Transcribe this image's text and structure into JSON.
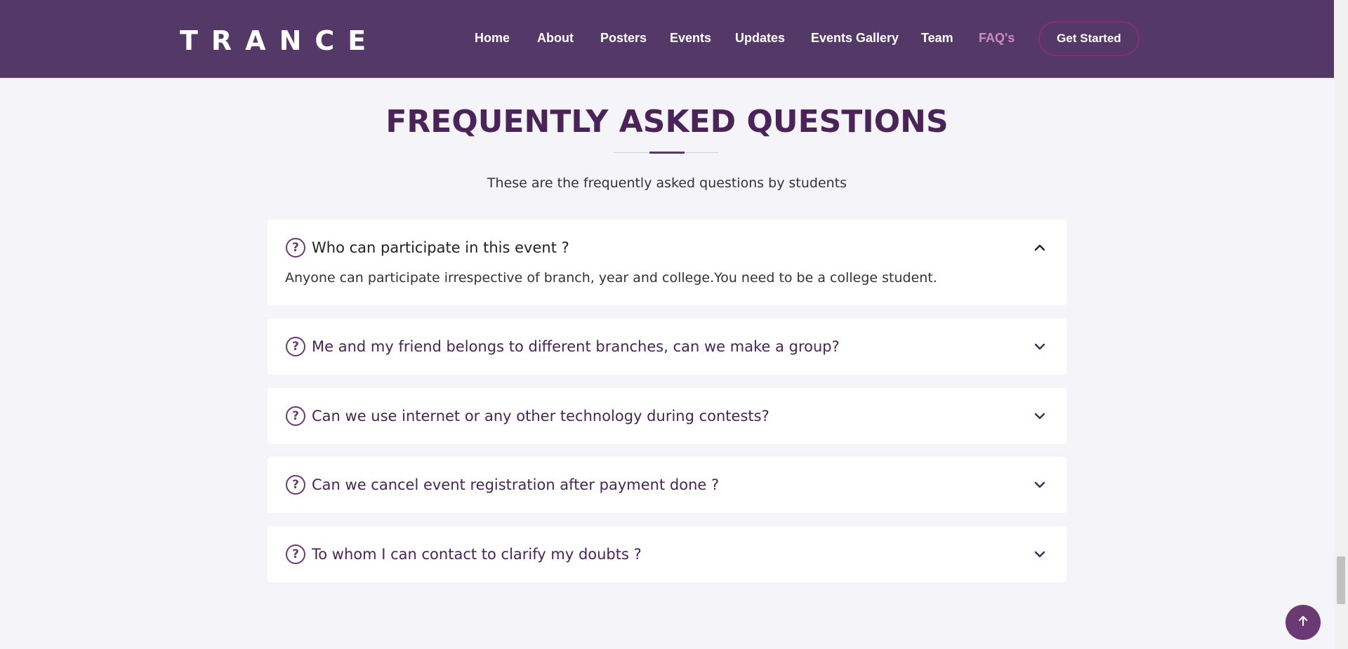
{
  "header": {
    "logo": "TRANCE",
    "nav": [
      {
        "label": "Home",
        "active": false
      },
      {
        "label": "About",
        "active": false
      },
      {
        "label": "Posters",
        "active": false
      },
      {
        "label": "Events",
        "active": false
      },
      {
        "label": "Updates",
        "active": false
      },
      {
        "label": "Events Gallery",
        "active": false
      },
      {
        "label": "Team",
        "active": false
      },
      {
        "label": "FAQ's",
        "active": true
      }
    ],
    "cta_label": "Get Started"
  },
  "faq": {
    "title": "FREQUENTLY ASKED QUESTIONS",
    "subtitle": "These are the frequently asked questions by students",
    "items": [
      {
        "question": "Who can participate in this event ?",
        "answer": "Anyone can participate irrespective of branch, year and college.You need to be a college student.",
        "expanded": true
      },
      {
        "question": "Me and my friend belongs to different branches, can we make a group?",
        "expanded": false
      },
      {
        "question": "Can we use internet or any other technology during contests?",
        "expanded": false
      },
      {
        "question": "Can we cancel event registration after payment done ?",
        "expanded": false
      },
      {
        "question": "To whom I can contact to clarify my doubts ?",
        "expanded": false
      }
    ]
  },
  "colors": {
    "header_bg": "#543868",
    "accent": "#4a2458",
    "active_nav": "#d08ac0",
    "page_bg": "#f4f4f9"
  },
  "icons": {
    "question": "question-circle-icon",
    "expanded": "chevron-up-icon",
    "collapsed": "chevron-down-icon",
    "back_to_top": "arrow-up-icon"
  }
}
